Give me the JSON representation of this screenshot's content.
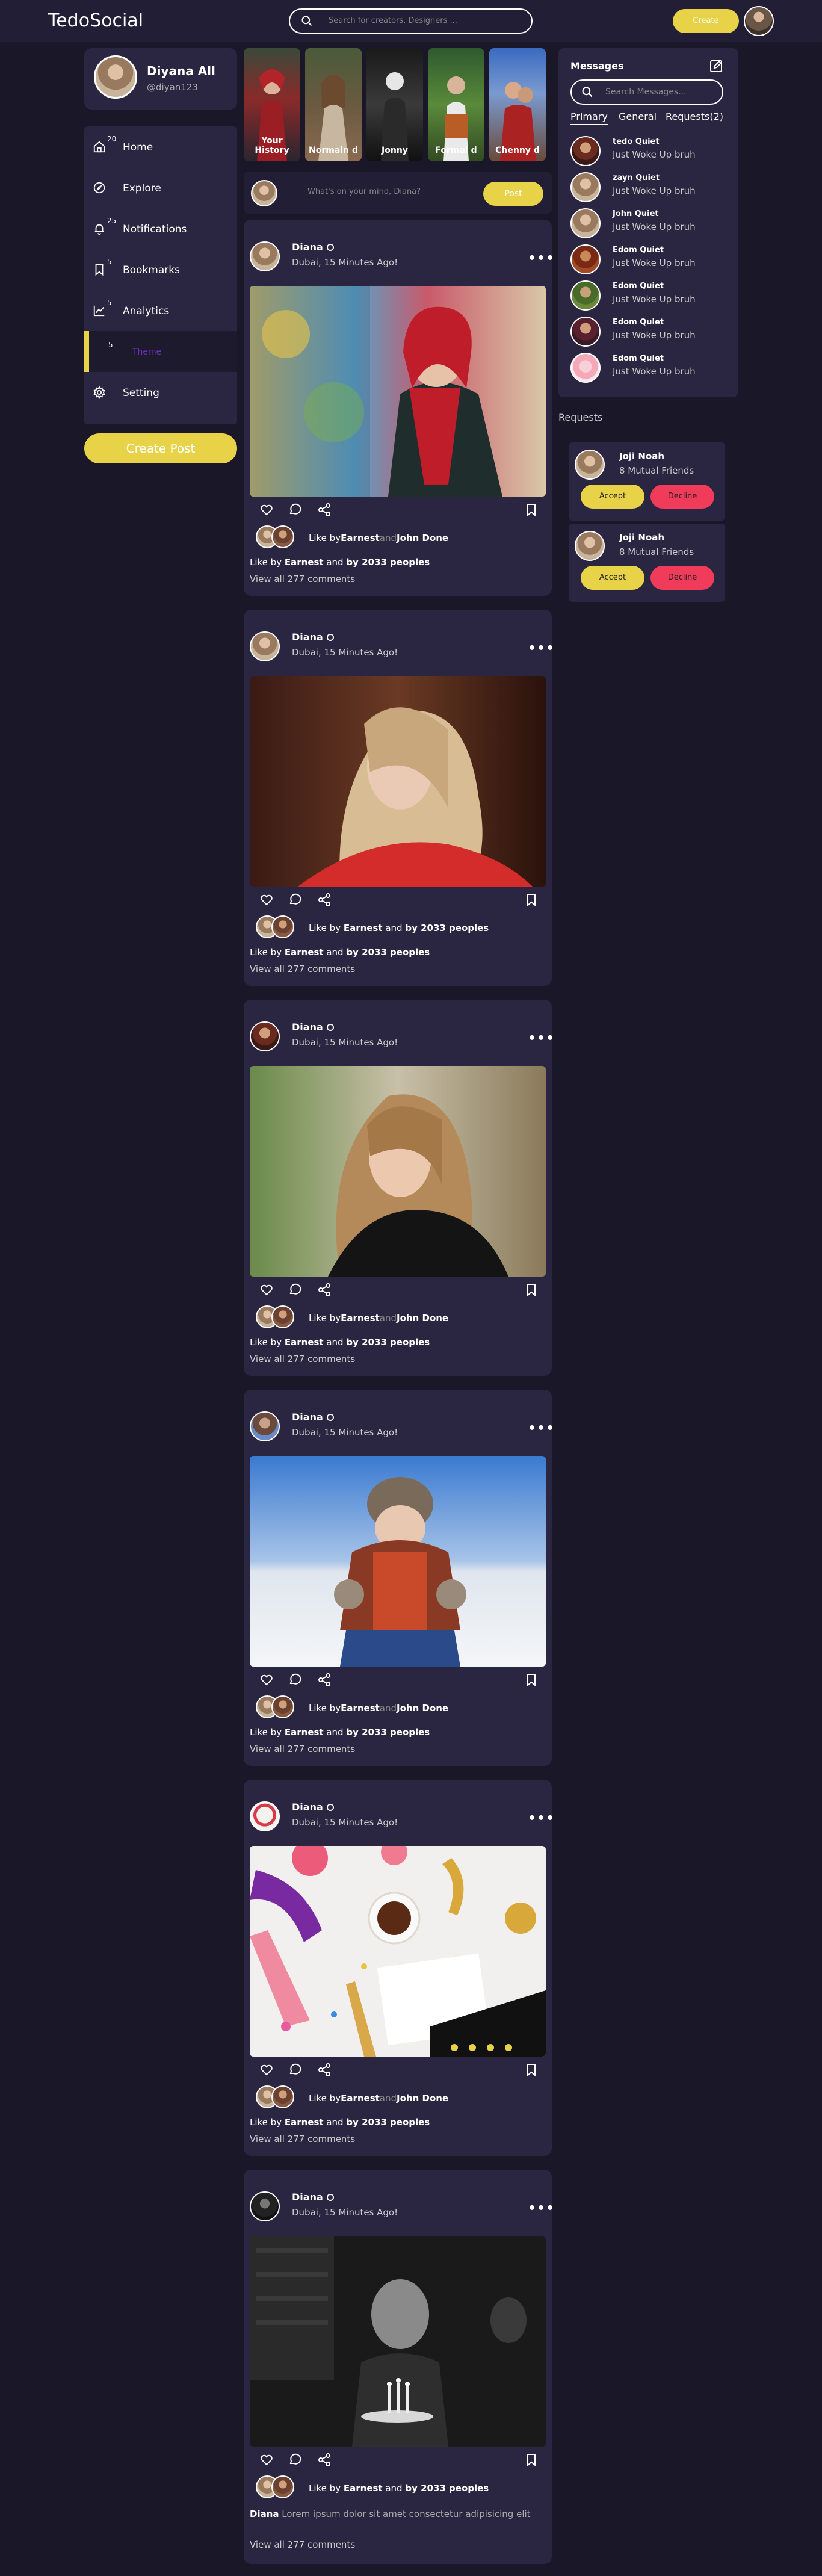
{
  "nav": {
    "logo": "TedoSocial",
    "search_placeholder": "Search for creators, Designers ...",
    "create_label": "Create"
  },
  "profile": {
    "name": "Diyana All",
    "handle": "@diyan123"
  },
  "menu": [
    {
      "label": "Home",
      "badge": "20",
      "icon": "home-icon"
    },
    {
      "label": "Explore",
      "badge": "",
      "icon": "compass-icon"
    },
    {
      "label": "Notifications",
      "badge": "25",
      "icon": "bell-icon"
    },
    {
      "label": "Bookmarks",
      "badge": "5",
      "icon": "bookmark-icon"
    },
    {
      "label": "Analytics",
      "badge": "5",
      "icon": "chart-icon"
    },
    {
      "label": "Theme",
      "badge": "5",
      "icon": "palette-icon"
    },
    {
      "label": "Setting",
      "badge": "",
      "icon": "gear-icon"
    }
  ],
  "create_post_label": "Create Post",
  "stories": [
    {
      "label": "Your History"
    },
    {
      "label": "Normaln d"
    },
    {
      "label": "Jonny"
    },
    {
      "label": "Formal d"
    },
    {
      "label": "Chenny d"
    }
  ],
  "composer": {
    "placeholder": "What's on your mind, Diana?",
    "post_label": "Post"
  },
  "posts": [
    {
      "author": "Diana",
      "location": "Dubai, 15 Minutes Ago!",
      "likes_a": "Like by",
      "likes_b": "Earnest",
      "likes_c": "and",
      "likes_d": "John Done",
      "sum_a": "Like by ",
      "sum_b": "Earnest",
      "sum_c": " and ",
      "sum_d": "by 2033 peoples",
      "view_all": "View all 277 comments"
    },
    {
      "author": "Diana",
      "location": "Dubai, 15 Minutes Ago!",
      "likes_a": "Like by ",
      "likes_b": "Earnest",
      "likes_c": " and ",
      "likes_d": "by 2033 peoples",
      "sum_a": "Like by ",
      "sum_b": "Earnest",
      "sum_c": " and ",
      "sum_d": "by 2033 peoples",
      "view_all": "View all 277 comments"
    },
    {
      "author": "Diana",
      "location": "Dubai, 15 Minutes Ago!",
      "likes_a": "Like by",
      "likes_b": "Earnest",
      "likes_c": "and",
      "likes_d": "John Done",
      "sum_a": "Like by ",
      "sum_b": "Earnest",
      "sum_c": " and ",
      "sum_d": "by 2033 peoples",
      "view_all": "View all 277 comments"
    },
    {
      "author": "Diana",
      "location": "Dubai, 15 Minutes Ago!",
      "likes_a": "Like by",
      "likes_b": "Earnest",
      "likes_c": "and",
      "likes_d": "John Done",
      "sum_a": "Like by ",
      "sum_b": "Earnest",
      "sum_c": " and ",
      "sum_d": "by 2033 peoples",
      "view_all": "View all 277 comments"
    },
    {
      "author": "Diana",
      "location": "Dubai, 15 Minutes Ago!",
      "likes_a": "Like by",
      "likes_b": "Earnest",
      "likes_c": "and",
      "likes_d": "John Done",
      "sum_a": "Like by ",
      "sum_b": "Earnest",
      "sum_c": " and ",
      "sum_d": "by 2033 peoples",
      "view_all": "View all 277 comments"
    },
    {
      "author": "Diana",
      "location": "Dubai, 15 Minutes Ago!",
      "likes_a": "Like by ",
      "likes_b": "Earnest",
      "likes_c": " and ",
      "likes_d": "by 2033 peoples",
      "caption_name": "Diana",
      "caption_text": " Lorem ipsum dolor sit amet consectetur adipisicing elit",
      "view_all": "View all 277 comments"
    }
  ],
  "messages": {
    "title": "Messages",
    "search_placeholder": "Search Messages...",
    "tabs": [
      "Primary",
      "General",
      "Requests(2)"
    ],
    "items": [
      {
        "name": "tedo Quiet",
        "text": "Just Woke Up bruh"
      },
      {
        "name": "zayn Quiet",
        "text": "Just Woke Up bruh"
      },
      {
        "name": "John Quiet",
        "text": "Just Woke Up bruh"
      },
      {
        "name": "Edom Quiet",
        "text": "Just Woke Up bruh"
      },
      {
        "name": "Edom Quiet",
        "text": "Just Woke Up bruh"
      },
      {
        "name": "Edom Quiet",
        "text": "Just Woke Up bruh"
      },
      {
        "name": "Edom Quiet",
        "text": "Just Woke Up bruh"
      }
    ]
  },
  "requests": {
    "title": "Requests",
    "items": [
      {
        "name": "Joji Noah",
        "mutual": "8 Mutual Friends",
        "accept": "Accept",
        "decline": "Decline"
      },
      {
        "name": "Joji Noah",
        "mutual": "8 Mutual Friends",
        "accept": "Accept",
        "decline": "Decline"
      }
    ]
  },
  "colors": {
    "accent": "#e8d348",
    "decline": "#f03b5a",
    "bg": "#1a1728",
    "card": "#2a2540",
    "nav": "#221e35",
    "theme_label": "#6f2dbd"
  }
}
